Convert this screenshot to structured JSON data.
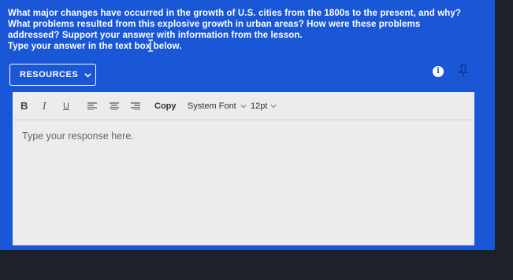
{
  "question": {
    "lines": [
      "What major changes have occurred in the growth of U.S. cities from the 1800s to the present, and why?",
      "What problems resulted from this explosive growth in urban areas? How were these problems",
      "addressed? Support your answer with information from the lesson.",
      "Type your answer in the text box below."
    ]
  },
  "resources": {
    "label": "RESOURCES",
    "icon": "chevron-down-icon"
  },
  "header_icons": {
    "info": "info-icon",
    "info_glyph": "i",
    "pin": "pin-icon"
  },
  "toolbar": {
    "bold": "B",
    "italic": "I",
    "underline": "U",
    "copy": "Copy",
    "font": "System Font",
    "size": "12pt"
  },
  "editor": {
    "placeholder": "Type your response here."
  },
  "colors": {
    "accent": "#1a57d6",
    "editor_bg": "#ececec",
    "page_bg": "#1d2129"
  }
}
